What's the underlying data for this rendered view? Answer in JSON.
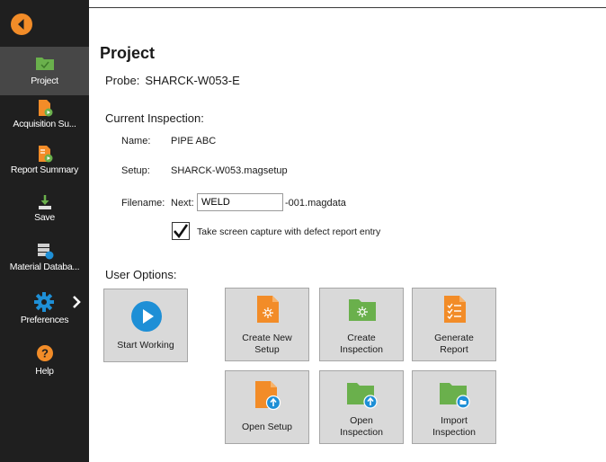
{
  "sidebar": {
    "items": [
      {
        "label": "Project",
        "icon": "folder-check-icon"
      },
      {
        "label": "Acquisition Su...",
        "icon": "acquisition-icon"
      },
      {
        "label": "Report Summary",
        "icon": "report-summary-icon"
      },
      {
        "label": "Save",
        "icon": "save-icon"
      },
      {
        "label": "Material Databa...",
        "icon": "database-icon"
      },
      {
        "label": "Preferences",
        "icon": "gear-icon"
      },
      {
        "label": "Help",
        "icon": "help-icon"
      }
    ]
  },
  "main": {
    "title": "Project",
    "probe_label": "Probe:",
    "probe_value": "SHARCK-W053-E",
    "current_inspection_heading": "Current Inspection:",
    "name_label": "Name:",
    "name_value": "PIPE ABC",
    "setup_label": "Setup:",
    "setup_value": "SHARCK-W053.magsetup",
    "filename_label": "Filename:",
    "next_label": "Next:",
    "filename_input": "WELD",
    "filename_suffix": "-001.magdata",
    "capture_label": "Take screen capture with defect report entry",
    "capture_checked": true,
    "user_options_heading": "User Options:"
  },
  "tiles": {
    "start_working": "Start Working",
    "create_new_setup": [
      "Create New",
      "Setup"
    ],
    "create_inspection": [
      "Create",
      "Inspection"
    ],
    "generate_report": [
      "Generate",
      "Report"
    ],
    "open_setup": "Open Setup",
    "open_inspection": [
      "Open",
      "Inspection"
    ],
    "import_inspection": [
      "Import",
      "Inspection"
    ]
  },
  "colors": {
    "sidebar_bg": "#1f1f1f",
    "sidebar_active": "#474747",
    "accent_orange": "#f28c28",
    "green": "#6ab04c",
    "blue": "#1e8fd6"
  }
}
